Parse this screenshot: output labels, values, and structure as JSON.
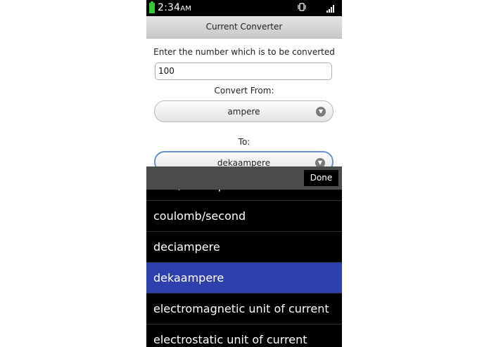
{
  "status_bar": {
    "time": "2:34",
    "ampm": "AM",
    "vibrate_icon": "vibrate-icon",
    "signal_icon": "signal-bars-icon",
    "battery_icon": "battery-icon"
  },
  "header": {
    "title": "Current Converter"
  },
  "form": {
    "number_prompt": "Enter the number which is to be converted",
    "number_value": "100",
    "from_label": "Convert From:",
    "from_value": "ampere",
    "to_label": "To:",
    "to_value": "dekaampere"
  },
  "picker": {
    "done_label": "Done",
    "items": [
      {
        "label": "biot / abampere"
      },
      {
        "label": "coulomb/second"
      },
      {
        "label": "deciampere"
      },
      {
        "label": "dekaampere",
        "selected": true
      },
      {
        "label": "electromagnetic unit of current"
      },
      {
        "label": "electrostatic unit of current"
      }
    ]
  },
  "colors": {
    "selected_row": "#2e3fb0",
    "status_bar": "#000000",
    "battery": "#37c837"
  }
}
